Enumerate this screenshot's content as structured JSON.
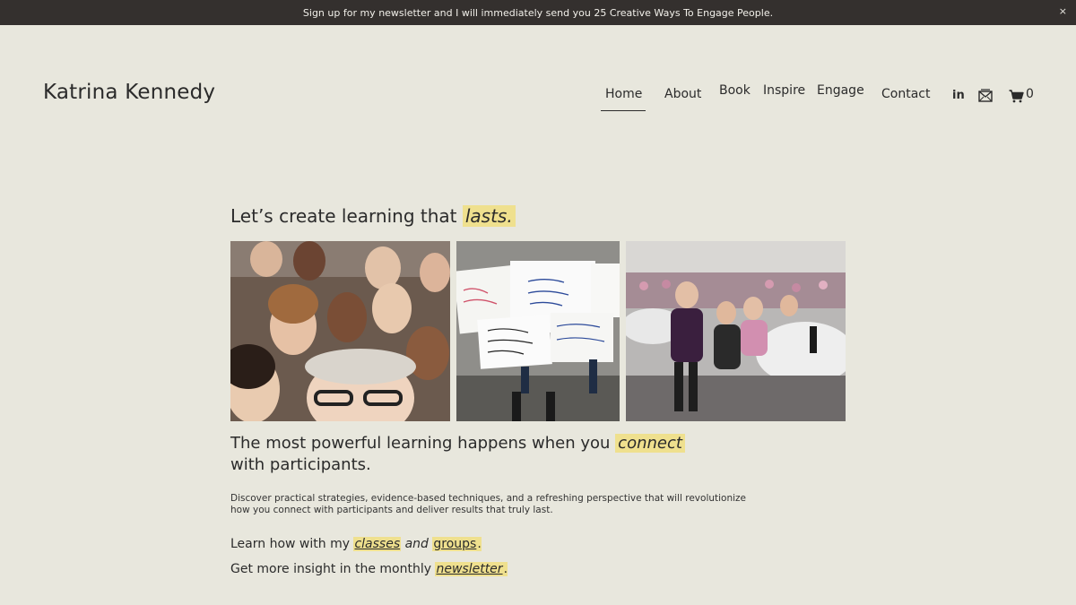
{
  "announcement": {
    "text": "Sign up for my newsletter and I will immediately send you 25 Creative Ways To Engage People.",
    "close": "×"
  },
  "brand": "Katrina Kennedy",
  "nav": {
    "home": "Home",
    "about": "About",
    "book": "Book",
    "inspire": "Inspire",
    "engage": "Engage",
    "contact": "Contact",
    "linkedin": "in",
    "cart_count": "0"
  },
  "hero": {
    "title_prefix": "Let’s create learning that ",
    "title_highlight": "lasts."
  },
  "subhead": {
    "prefix": "The most powerful learning happens when you ",
    "highlight": "connect",
    "suffix": " with participants."
  },
  "paragraph": "Discover practical strategies, evidence-based techniques, and a refreshing perspective that will revolutionize how you connect with participants and deliver results that truly last.",
  "learn": {
    "prefix": "Learn how with my ",
    "classes": "classes",
    "and": " and ",
    "groups": "groups",
    "end": "."
  },
  "insight": {
    "prefix": "Get more insight in the monthly ",
    "newsletter": "newsletter",
    "end": "."
  },
  "icons": {
    "linkedin": "linkedin-icon",
    "email": "email-icon",
    "cart": "cart-icon"
  },
  "colors": {
    "background": "#e8e7dd",
    "announcement_bar": "#34302e",
    "highlight": "#efe08e"
  }
}
